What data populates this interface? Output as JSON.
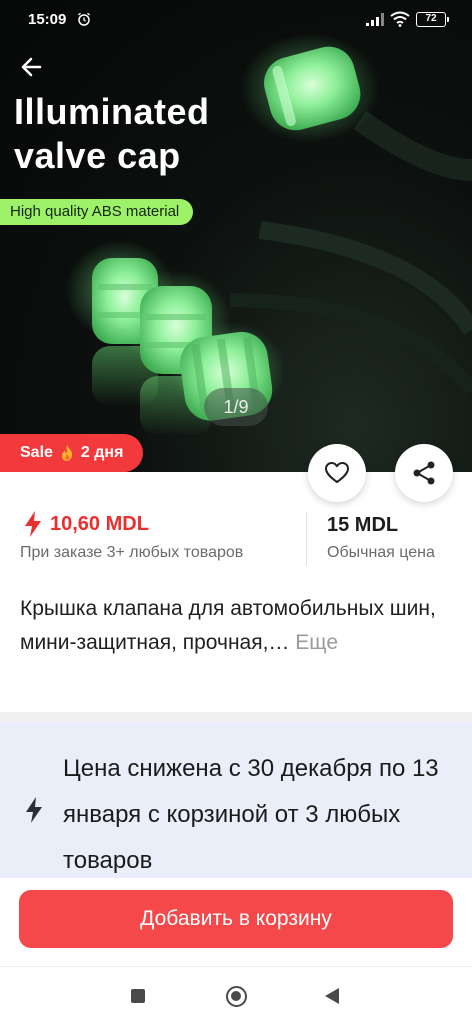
{
  "status_bar": {
    "time": "15:09",
    "battery": "72"
  },
  "hero": {
    "title_line1": "Illuminated",
    "title_line2": "valve cap",
    "badge": "High quality ABS material",
    "image_counter": "1/9",
    "sale_label": "Sale",
    "sale_days": "2 дня",
    "glow_color": "#8ff09a"
  },
  "price": {
    "promo_price": "10,60 MDL",
    "promo_note": "При заказе 3+ любых товаров",
    "regular_price": "15 MDL",
    "regular_note": "Обычная цена",
    "promo_color": "#e8302f"
  },
  "product": {
    "title": "Крышка клапана для автомобильных шин, мини-защитная, прочная,…",
    "more_link": "Еще"
  },
  "promo_panel": {
    "text": "Цена снижена с 30 декабря по 13 января с корзиной от 3 любых товаров"
  },
  "actions": {
    "add_to_cart": "Добавить в корзину",
    "accent_color": "#f4484a"
  },
  "icons": [
    "back-arrow-icon",
    "alarm-icon",
    "signal-icon",
    "wifi-icon",
    "battery-icon",
    "flame-icon",
    "heart-icon",
    "share-icon",
    "lightning-bolt-icon",
    "nav-recents-icon",
    "nav-home-icon",
    "nav-back-icon"
  ]
}
